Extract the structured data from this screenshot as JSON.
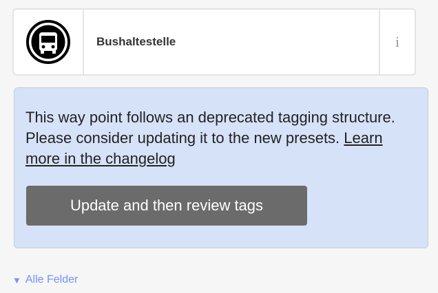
{
  "preset": {
    "icon": "bus-icon",
    "name": "Bushaltestelle",
    "info_label": "i"
  },
  "notice": {
    "message": "This way point follows an deprecated tagging structure. Please consider updating it to the new presets.",
    "link_label": "Learn more in the changelog",
    "button_label": "Update and then review tags"
  },
  "fields_toggle": {
    "icon": "triangle-down-icon",
    "label": "Alle Felder"
  },
  "colors": {
    "notice_background": "#d6e2f8",
    "button_background": "#6b6b6b",
    "link_blue": "#7092ff"
  }
}
